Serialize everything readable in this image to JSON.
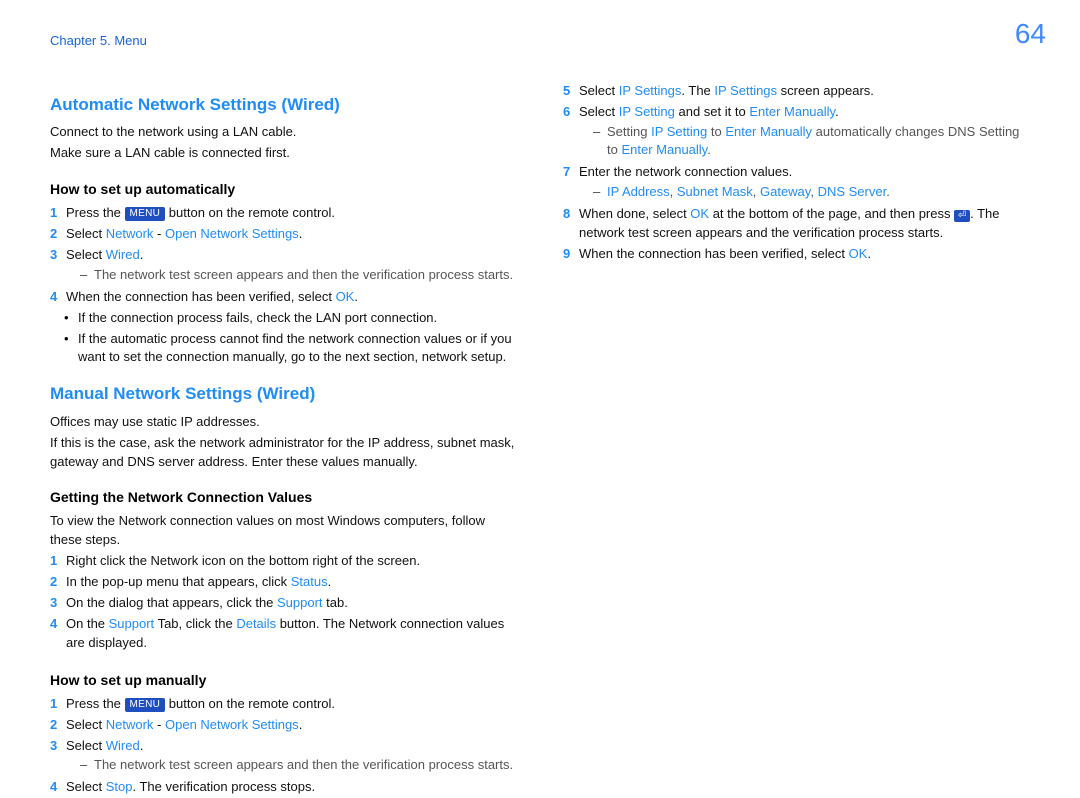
{
  "runhead": "Chapter 5. Menu",
  "pagenum": "64",
  "h_auto": "Automatic Network Settings (Wired)",
  "auto_intro1": "Connect to the network using a LAN cable.",
  "auto_intro2": "Make sure a LAN cable is connected first.",
  "h_auto_sub": "How to set up automatically",
  "auto1a": "Press the ",
  "auto1b": " button on the remote control.",
  "auto2a": "Select ",
  "auto2_net": "Network",
  "auto2_sep": " - ",
  "auto2_ons": "Open Network Settings",
  "period": ".",
  "auto3a": "Select ",
  "auto3_wired": "Wired",
  "auto3_dash": "The network test screen appears and then the verification process starts.",
  "auto4a": "When the connection has been verified, select ",
  "auto4_ok": "OK",
  "auto_bul1": "If the connection process fails, check the LAN port connection.",
  "auto_bul2": "If the automatic process cannot find the network connection values or if you want to set the connection manually, go to the next section, network setup.",
  "h_manual": "Manual Network Settings (Wired)",
  "man_p1": "Offices may use static IP addresses.",
  "man_p2": "If this is the case, ask the network administrator for the IP address, subnet mask, gateway and DNS server address. Enter these values manually.",
  "h_get": "Getting the Network Connection Values",
  "get_intro": "To view the Network connection values on most Windows computers, follow these steps.",
  "get1": "Right click the Network icon on the bottom right of the screen.",
  "get2a": "In the pop-up menu that appears, click ",
  "get2_status": "Status",
  "get3a": "On the dialog that appears, click the ",
  "get3_support": "Support",
  "get3b": " tab.",
  "get4a": "On the ",
  "get4_support": "Support",
  "get4b": " Tab, click the ",
  "get4_details": "Details",
  "get4c": " button. The Network connection values are displayed.",
  "h_man_sub": "How to set up manually",
  "m1a": "Press the ",
  "m1b": " button on the remote control.",
  "m2a": "Select ",
  "m2_net": "Network",
  "m2_sep": " - ",
  "m2_ons": "Open Network Settings",
  "m3a": "Select ",
  "m3_wired": "Wired",
  "m3_dash": "The network test screen appears and then the verification process starts.",
  "m4a": "Select ",
  "m4_stop": "Stop",
  "m4b": ". The verification process stops.",
  "r5a": "Select ",
  "r5_ips": "IP Settings",
  "r5b": ". The ",
  "r5_ips2": "IP Settings",
  "r5c": " screen appears.",
  "r6a": "Select ",
  "r6_ip": "IP Setting",
  "r6b": " and set it to ",
  "r6_em": "Enter Manually",
  "r6_dash_a": "Setting ",
  "r6_dash_ip": "IP Setting",
  "r6_dash_b": " to ",
  "r6_dash_em": "Enter Manually",
  "r6_dash_c": " automatically changes DNS Setting to ",
  "r6_dash_em2": "Enter Manually",
  "r7": "Enter the network connection values.",
  "r7_dash": "IP Address, Subnet Mask, Gateway, DNS Server",
  "r7_ip": "IP Address",
  "r7_c1": ", ",
  "r7_sm": "Subnet Mask",
  "r7_c2": ", ",
  "r7_gw": "Gateway",
  "r7_c3": ", ",
  "r7_dns": "DNS Server",
  "r8a": "When done, select ",
  "r8_ok": "OK",
  "r8b": " at the bottom of the page, and then press ",
  "r8c": ". The network test screen appears and the verification process starts.",
  "r9a": "When the connection has been verified, select ",
  "r9_ok": "OK",
  "chip_menu": "MENU",
  "chip_enter": "⏎"
}
